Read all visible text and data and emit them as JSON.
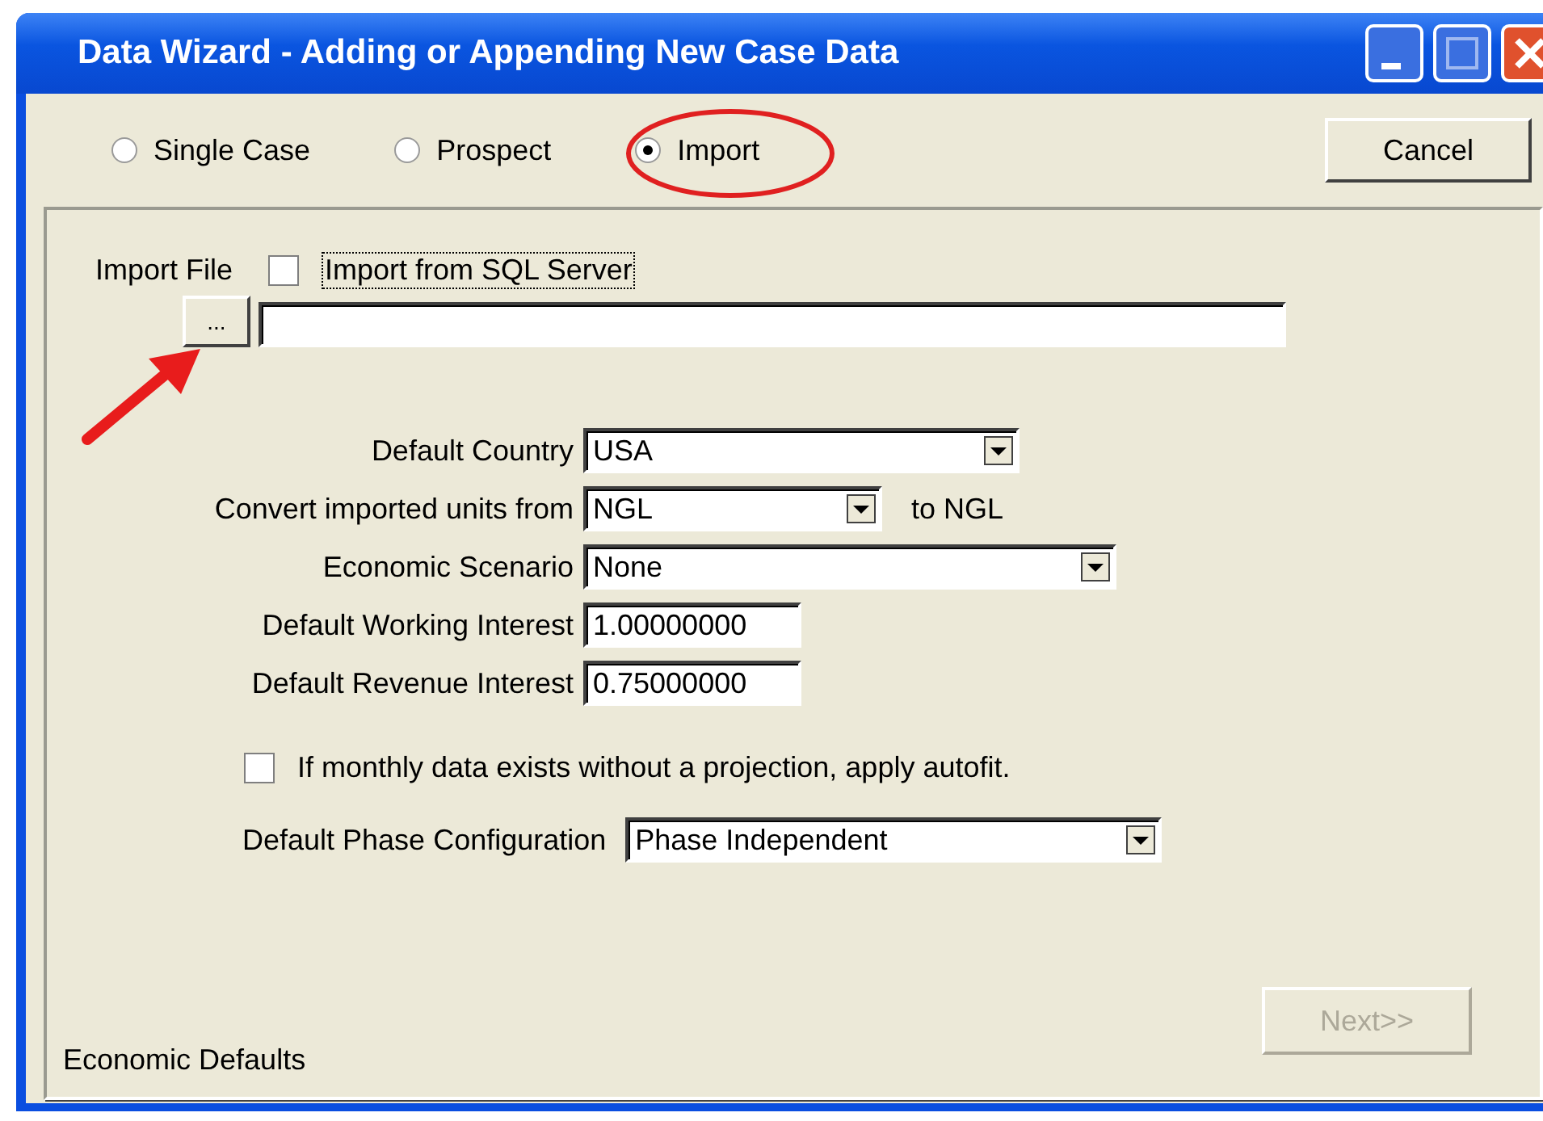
{
  "window": {
    "title": "Data Wizard - Adding or Appending New Case Data"
  },
  "modes": [
    {
      "label": "Single Case",
      "selected": false
    },
    {
      "label": "Prospect",
      "selected": false
    },
    {
      "label": "Import",
      "selected": true
    }
  ],
  "cancel_button": "Cancel",
  "import_file": {
    "label": "Import File",
    "browse_button": "...",
    "sql_checkbox": {
      "label": "Import from SQL Server",
      "checked": false
    }
  },
  "fields": [
    {
      "kind": "select",
      "label": "Default Country",
      "value": "USA"
    },
    {
      "kind": "select",
      "label": "Convert imported units from",
      "value": "NGL",
      "suffix": "to NGL"
    },
    {
      "kind": "select",
      "label": "Economic Scenario",
      "value": "None"
    },
    {
      "kind": "input",
      "label": "Default Working Interest",
      "value": "1.00000000"
    },
    {
      "kind": "input",
      "label": "Default Revenue Interest",
      "value": "0.75000000"
    }
  ],
  "autofit_checkbox": {
    "label": "If monthly data exists without a projection, apply autofit.",
    "checked": false
  },
  "phase_configuration": {
    "label": "Default Phase Configuration",
    "value": "Phase Independent"
  },
  "footer_label": "Economic Defaults",
  "next_button": {
    "label": "Next>>",
    "disabled": true
  }
}
